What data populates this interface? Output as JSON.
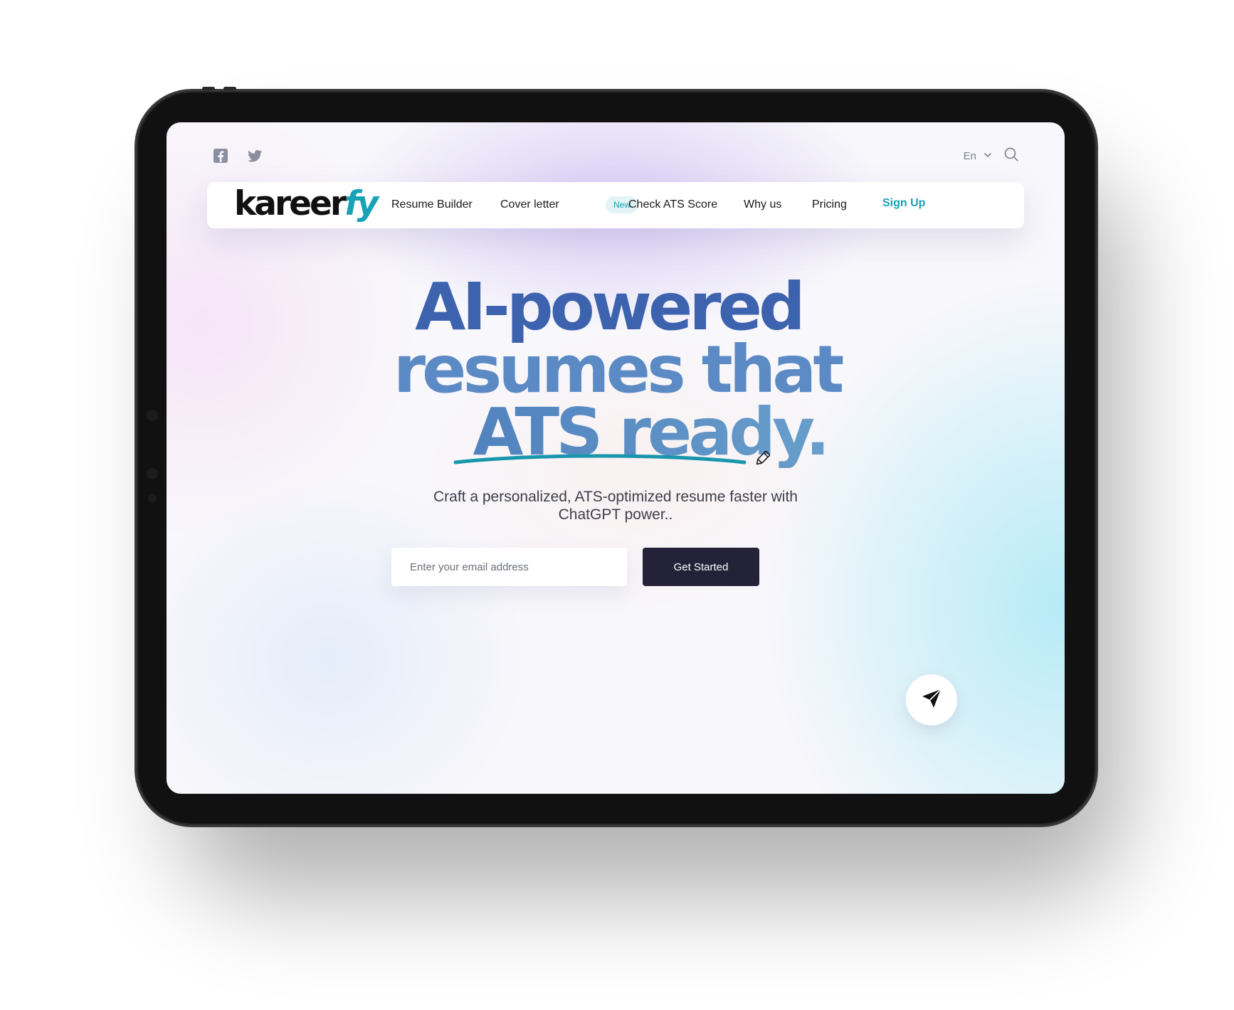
{
  "brand": {
    "name_main": "kareer",
    "name_accent": "fy"
  },
  "topbar": {
    "social_icons": [
      "facebook-icon",
      "twitter-icon"
    ],
    "language": "En"
  },
  "nav": {
    "items": [
      {
        "label": "Resume Builder"
      },
      {
        "label": "Cover letter"
      },
      {
        "label": "Check ATS Score"
      },
      {
        "label": "Why us"
      },
      {
        "label": "Pricing"
      },
      {
        "label": "Sign Up"
      }
    ],
    "badge": "New"
  },
  "hero": {
    "line1": "AI-powered",
    "line2": "resumes that",
    "line3": "ATS ready.",
    "subtitle_line1": "Craft a personalized, ATS-optimized resume faster with",
    "subtitle_line2": "ChatGPT power.."
  },
  "form": {
    "email_placeholder": "Enter your email address",
    "email_value": "",
    "cta_label": "Get Started"
  },
  "colors": {
    "accent": "#1a9fb5",
    "hero_dark_blue": "#3d63ae",
    "cta_background": "#232238"
  },
  "icons": {
    "search": "search-icon",
    "chevron": "chevron-down-icon",
    "pencil": "pencil-icon",
    "send": "send-icon"
  }
}
